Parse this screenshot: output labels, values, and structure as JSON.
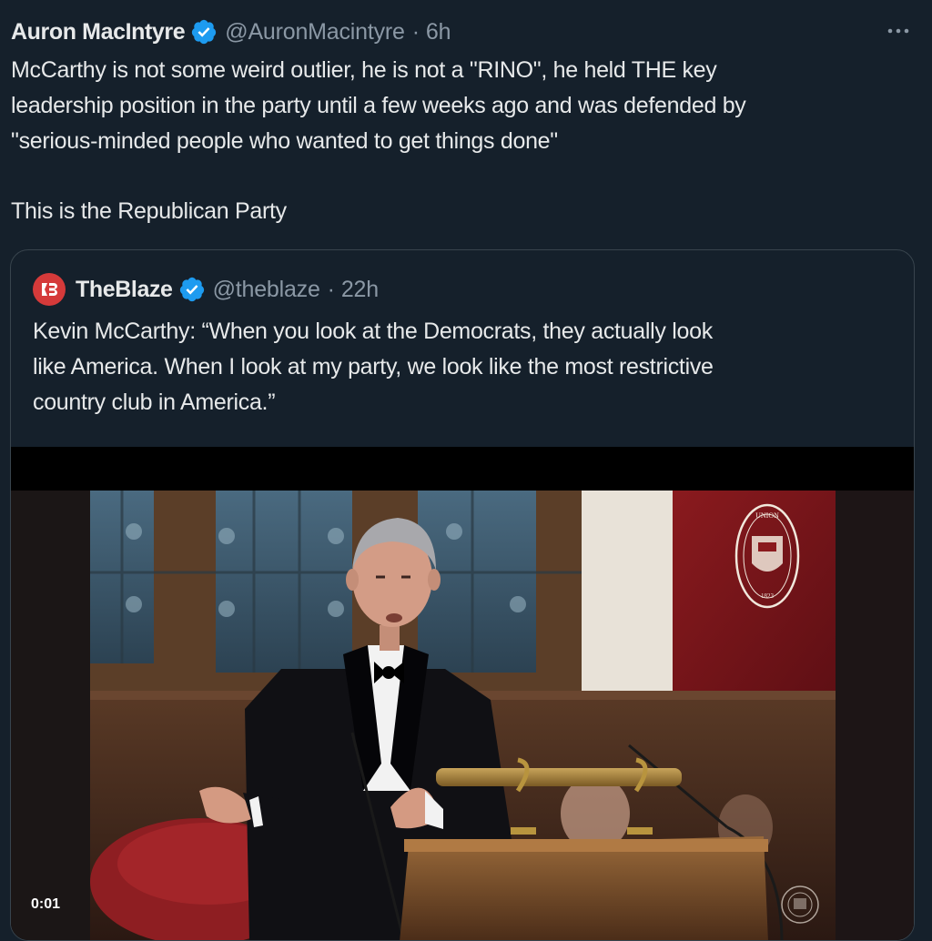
{
  "tweet": {
    "author_name": "Auron MacIntyre",
    "handle": "@AuronMacintyre",
    "separator": "·",
    "time": "6h",
    "more_icon": "more-horizontal-icon",
    "text_paragraph_1": "McCarthy is not some weird outlier, he is not a \"RINO\", he held THE key\nleadership position in the party until a few weeks ago and was defended by\n\"serious-minded people who wanted to get things done\"",
    "text_paragraph_2": "This is the Republican Party"
  },
  "quoted_tweet": {
    "author_name": "TheBlaze",
    "handle": "@theblaze",
    "separator": "·",
    "time": "22h",
    "text": "Kevin McCarthy: “When you look at the Democrats, they actually look\nlike America. When I look at my party, we look like the most restrictive\ncountry club in America.”",
    "video_time": "0:01",
    "watermark_text": "OXFORD UNION SOCIETY"
  },
  "colors": {
    "background": "#15202b",
    "text": "#e7e9ea",
    "secondary_text": "#8b98a5",
    "verified_blue": "#1d9bf0",
    "blaze_red": "#d53a3a",
    "border": "#38444d"
  }
}
